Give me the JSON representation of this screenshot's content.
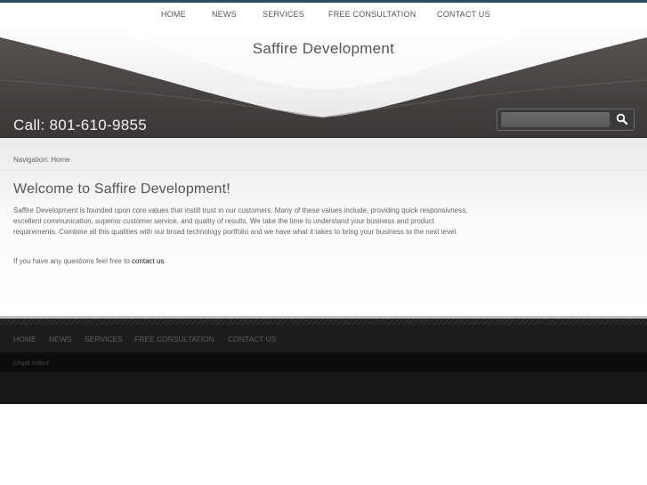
{
  "top_nav": {
    "items": [
      {
        "label": "HOME"
      },
      {
        "label": "NEWS"
      },
      {
        "label": "SERVICES"
      },
      {
        "label": "FREE CONSULTATION"
      },
      {
        "label": "CONTACT US"
      }
    ]
  },
  "header": {
    "site_title": "Saffire Development",
    "phone": "Call: 801-610-9855",
    "search": {
      "placeholder": "",
      "button_icon": "search-icon"
    }
  },
  "breadcrumb": {
    "text": "Navigation: Home"
  },
  "main": {
    "heading": "Welcome to Saffire Development!",
    "paragraph1": "Saffire Development is founded upon core values that instill trust in our customers. Many of these values include, providing quick responsivness, excellent communication, superior customer service, and quality of results. We take the time to understand your business and product requirements. Combine all this qualities with our broad technology portfolio and we have what it takes to bring your business to the next level.",
    "paragraph2_prefix": "If you have any questions feel free to ",
    "paragraph2_link": "contact us",
    "paragraph2_suffix": "."
  },
  "footer": {
    "nav": [
      {
        "label": "HOME"
      },
      {
        "label": "NEWS"
      },
      {
        "label": "SERVICES"
      },
      {
        "label": "FREE CONSULTATION"
      },
      {
        "label": "CONTACT US"
      }
    ],
    "legal": "Legal notice"
  },
  "colors": {
    "top_bar": "#2f4a63",
    "header_dark": "#4a4544",
    "footer_dark": "#1c1c1c"
  }
}
